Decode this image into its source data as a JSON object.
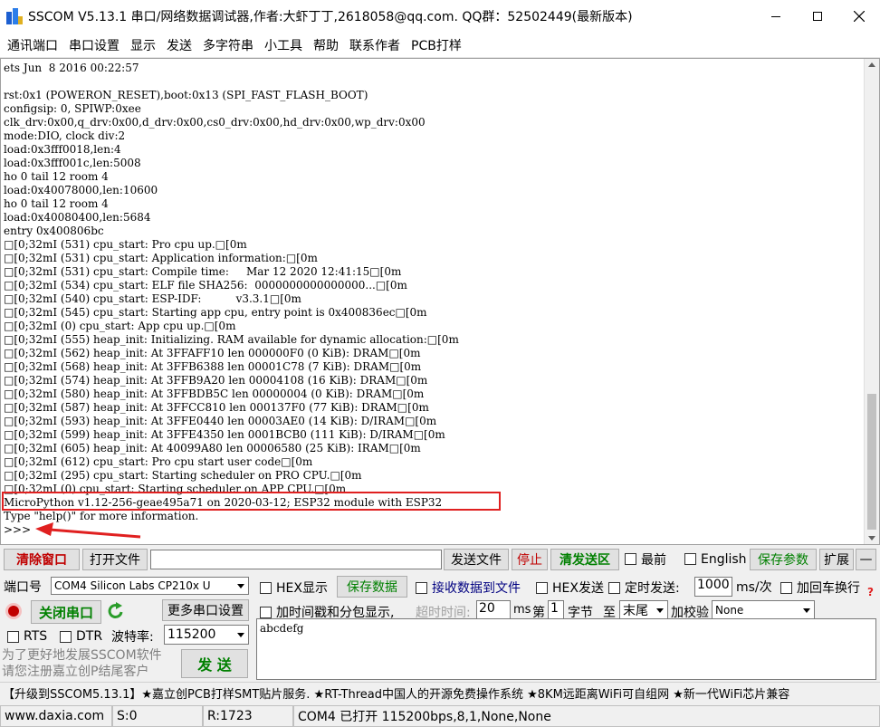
{
  "window": {
    "title": "SSCOM V5.13.1 串口/网络数据调试器,作者:大虾丁丁,2618058@qq.com. QQ群：52502449(最新版本)",
    "icon": "sscom-app-icon"
  },
  "menu": [
    "通讯端口",
    "串口设置",
    "显示",
    "发送",
    "多字符串",
    "小工具",
    "帮助",
    "联系作者",
    "PCB打样"
  ],
  "terminal": {
    "lines": [
      "ets Jun  8 2016 00:22:57",
      "",
      "rst:0x1 (POWERON_RESET),boot:0x13 (SPI_FAST_FLASH_BOOT)",
      "configsip: 0, SPIWP:0xee",
      "clk_drv:0x00,q_drv:0x00,d_drv:0x00,cs0_drv:0x00,hd_drv:0x00,wp_drv:0x00",
      "mode:DIO, clock div:2",
      "load:0x3fff0018,len:4",
      "load:0x3fff001c,len:5008",
      "ho 0 tail 12 room 4",
      "load:0x40078000,len:10600",
      "ho 0 tail 12 room 4",
      "load:0x40080400,len:5684",
      "entry 0x400806bc",
      "□[0;32mI (531) cpu_start: Pro cpu up.□[0m",
      "□[0;32mI (531) cpu_start: Application information:□[0m",
      "□[0;32mI (531) cpu_start: Compile time:     Mar 12 2020 12:41:15□[0m",
      "□[0;32mI (534) cpu_start: ELF file SHA256:  0000000000000000...□[0m",
      "□[0;32mI (540) cpu_start: ESP-IDF:          v3.3.1□[0m",
      "□[0;32mI (545) cpu_start: Starting app cpu, entry point is 0x400836ec□[0m",
      "□[0;32mI (0) cpu_start: App cpu up.□[0m",
      "□[0;32mI (555) heap_init: Initializing. RAM available for dynamic allocation:□[0m",
      "□[0;32mI (562) heap_init: At 3FFAFF10 len 000000F0 (0 KiB): DRAM□[0m",
      "□[0;32mI (568) heap_init: At 3FFB6388 len 00001C78 (7 KiB): DRAM□[0m",
      "□[0;32mI (574) heap_init: At 3FFB9A20 len 00004108 (16 KiB): DRAM□[0m",
      "□[0;32mI (580) heap_init: At 3FFBDB5C len 00000004 (0 KiB): DRAM□[0m",
      "□[0;32mI (587) heap_init: At 3FFCC810 len 000137F0 (77 KiB): DRAM□[0m",
      "□[0;32mI (593) heap_init: At 3FFE0440 len 00003AE0 (14 KiB): D/IRAM□[0m",
      "□[0;32mI (599) heap_init: At 3FFE4350 len 0001BCB0 (111 KiB): D/IRAM□[0m",
      "□[0;32mI (605) heap_init: At 40099A80 len 00006580 (25 KiB): IRAM□[0m",
      "□[0;32mI (612) cpu_start: Pro cpu start user code□[0m",
      "□[0;32mI (295) cpu_start: Starting scheduler on PRO CPU.□[0m",
      "□[0;32mI (0) cpu_start: Starting scheduler on APP CPU.□[0m",
      "MicroPython v1.12-256-geae495a71 on 2020-03-12; ESP32 module with ESP32",
      "Type \"help()\" for more information.",
      ">>>"
    ]
  },
  "toolbar": {
    "clear_window": "清除窗口",
    "open_file": "打开文件",
    "send_file": "发送文件",
    "stop": "停止",
    "clear_send": "清发送区",
    "topmost": "最前",
    "english": "English",
    "save_params": "保存参数",
    "expand": "扩展",
    "collapse": "—"
  },
  "port": {
    "port_label": "端口号",
    "port_value": "COM4 Silicon Labs CP210x U",
    "hex_display": "HEX显示",
    "save_data": "保存数据",
    "recv_to_file": "接收数据到文件",
    "hex_send": "HEX发送",
    "timed_send": "定时发送:",
    "timed_value": "1000",
    "timed_unit": "ms/次",
    "add_crlf": "加回车换行",
    "close_port": "关闭串口",
    "more_settings": "更多串口设置",
    "add_timestamp": "加时间戳和分包显示,",
    "timeout_label": "超时时间:",
    "timeout_value": "20",
    "ms": "ms",
    "byte_prefix": "第",
    "byte_value": "1",
    "byte_suffix": "字节",
    "to": "至",
    "end_value": "末尾",
    "checksum_label": "加校验",
    "checksum_value": "None",
    "rts": "RTS",
    "dtr": "DTR",
    "baud_label": "波特率:",
    "baud_value": "115200",
    "send_text": "abcdefg",
    "send_button": "发 送",
    "promo_line1": "为了更好地发展SSCOM软件",
    "promo_line2": "请您注册嘉立创P结尾客户"
  },
  "news": "【升级到SSCOM5.13.1】★嘉立创PCB打样SMT贴片服务. ★RT-Thread中国人的开源免费操作系统 ★8KM远距离WiFi可自组网 ★新一代WiFi芯片兼容",
  "status": {
    "website": "www.daxia.com",
    "sent": "S:0",
    "received": "R:1723",
    "port_state": "COM4 已打开  115200bps,8,1,None,None"
  },
  "colors": {
    "accent_green": "#008000",
    "clear_red": "#c00000",
    "highlight": "#e02020"
  }
}
